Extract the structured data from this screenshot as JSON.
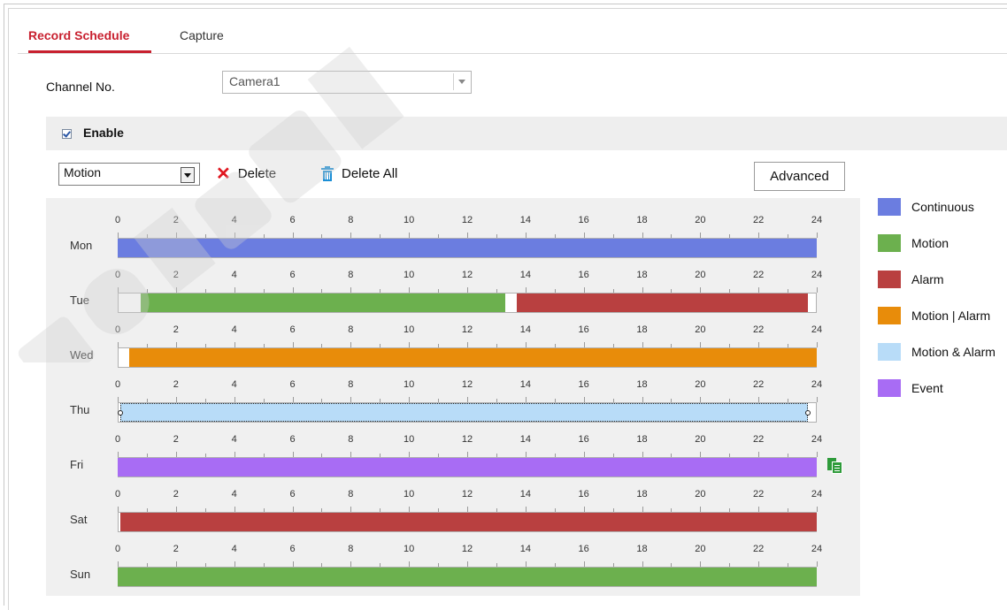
{
  "tabs": [
    {
      "label": "Record Schedule",
      "active": true
    },
    {
      "label": "Capture",
      "active": false
    }
  ],
  "channel": {
    "label": "Channel No.",
    "value": "Camera1"
  },
  "enable": {
    "label": "Enable",
    "checked": true
  },
  "toolbar": {
    "type_value": "Motion",
    "delete_label": "Delete",
    "delete_all_label": "Delete All",
    "advanced_label": "Advanced"
  },
  "hours": [
    "0",
    "2",
    "4",
    "6",
    "8",
    "10",
    "12",
    "14",
    "16",
    "18",
    "20",
    "22",
    "24"
  ],
  "colors": {
    "continuous": "#6b7de0",
    "motion": "#6cb04e",
    "alarm": "#b94040",
    "motion_or_alarm": "#e88c0a",
    "motion_and_alarm": "#b8dcf8",
    "event": "#a86cf4"
  },
  "days": [
    {
      "label": "Mon",
      "segments": [
        {
          "start": 0,
          "end": 24,
          "type": "continuous"
        }
      ]
    },
    {
      "label": "Tue",
      "segments": [
        {
          "start": 0.8,
          "end": 13.3,
          "type": "motion"
        },
        {
          "start": 13.7,
          "end": 23.7,
          "type": "alarm"
        }
      ]
    },
    {
      "label": "Wed",
      "segments": [
        {
          "start": 0.4,
          "end": 24,
          "type": "motion_or_alarm"
        }
      ]
    },
    {
      "label": "Thu",
      "segments": [
        {
          "start": 0.1,
          "end": 23.7,
          "type": "motion_and_alarm",
          "selected": true
        }
      ]
    },
    {
      "label": "Fri",
      "segments": [
        {
          "start": 0,
          "end": 24,
          "type": "event"
        }
      ]
    },
    {
      "label": "Sat",
      "segments": [
        {
          "start": 0.1,
          "end": 24,
          "type": "alarm"
        }
      ]
    },
    {
      "label": "Sun",
      "segments": [
        {
          "start": 0,
          "end": 24,
          "type": "motion"
        }
      ]
    }
  ],
  "legend": [
    {
      "label": "Continuous",
      "type": "continuous"
    },
    {
      "label": "Motion",
      "type": "motion"
    },
    {
      "label": "Alarm",
      "type": "alarm"
    },
    {
      "label": "Motion | Alarm",
      "type": "motion_or_alarm"
    },
    {
      "label": "Motion & Alarm",
      "type": "motion_and_alarm"
    },
    {
      "label": "Event",
      "type": "event"
    }
  ],
  "icons": {
    "delete": "close-x-icon",
    "delete_all": "trash-icon",
    "copy": "copy-icon",
    "dropdown": "chevron-down-icon"
  }
}
